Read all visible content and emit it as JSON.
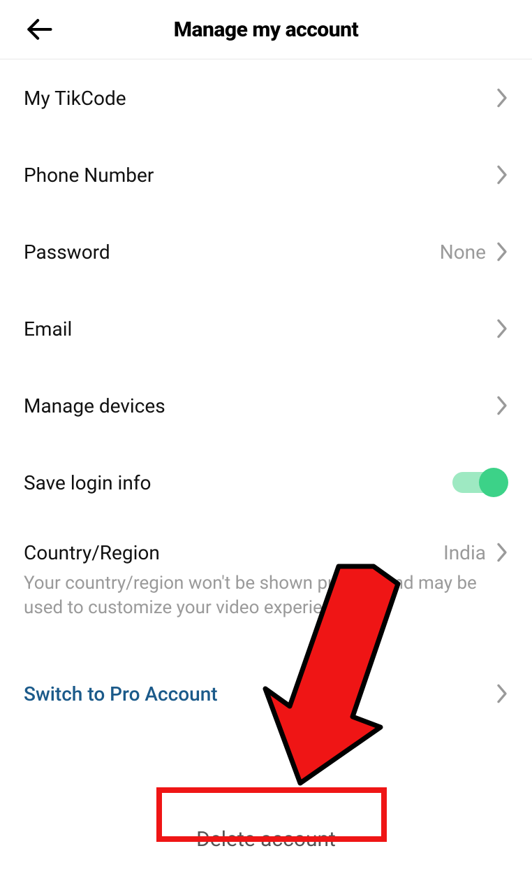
{
  "header": {
    "title": "Manage my account"
  },
  "rows": {
    "tikcode": {
      "label": "My TikCode"
    },
    "phone": {
      "label": "Phone Number"
    },
    "password": {
      "label": "Password",
      "value": "None"
    },
    "email": {
      "label": "Email"
    },
    "manage_devices": {
      "label": "Manage devices"
    },
    "save_login": {
      "label": "Save login info",
      "enabled": true
    },
    "country": {
      "label": "Country/Region",
      "value": "India",
      "subtext": "Your country/region won't be shown publicly and may be used to customize your video experience."
    },
    "switch_pro": {
      "label": "Switch to Pro Account"
    },
    "delete": {
      "label": "Delete account"
    }
  }
}
